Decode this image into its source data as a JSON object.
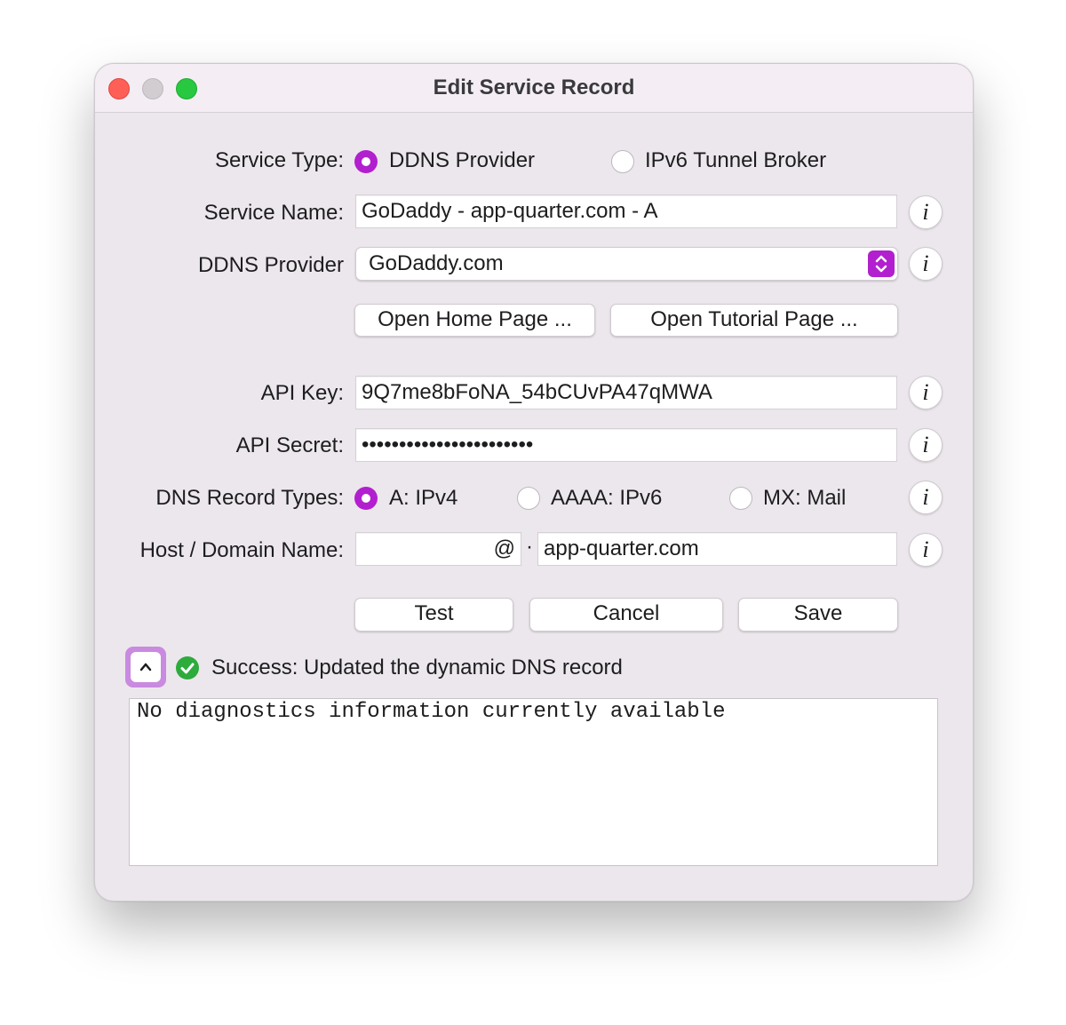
{
  "window": {
    "title": "Edit Service Record"
  },
  "service_type": {
    "label": "Service Type:",
    "options": [
      {
        "label": "DDNS Provider",
        "selected": true
      },
      {
        "label": "IPv6 Tunnel Broker",
        "selected": false
      }
    ]
  },
  "service_name": {
    "label": "Service Name:",
    "value": "GoDaddy - app-quarter.com - A"
  },
  "ddns_provider": {
    "label": "DDNS Provider",
    "value": "GoDaddy.com"
  },
  "links": {
    "home_page": "Open Home Page ...",
    "tutorial_page": "Open Tutorial Page ..."
  },
  "api_key": {
    "label": "API Key:",
    "value": "9Q7me8bFoNA_54bCUvPA47qMWA"
  },
  "api_secret": {
    "label": "API Secret:",
    "value": "•••••••••••••••••••••••"
  },
  "record_types": {
    "label": "DNS Record Types:",
    "options": [
      {
        "label": "A: IPv4",
        "selected": true
      },
      {
        "label": "AAAA: IPv6",
        "selected": false
      },
      {
        "label": "MX: Mail",
        "selected": false
      }
    ]
  },
  "host": {
    "label": "Host / Domain Name:",
    "host_value": "@",
    "separator": "·",
    "domain_value": "app-quarter.com"
  },
  "actions": {
    "test": "Test",
    "cancel": "Cancel",
    "save": "Save"
  },
  "status": {
    "message": "Success: Updated the dynamic DNS record"
  },
  "diagnostics": {
    "text": "No diagnostics information currently available"
  },
  "info_glyph": "i",
  "colors": {
    "accent": "#b21fcf",
    "success": "#2dab3c"
  },
  "icons": {
    "info": "info-icon",
    "success": "checkmark-circle-icon",
    "disclosure": "chevron-up-icon",
    "popup": "up-down-arrows-icon"
  }
}
